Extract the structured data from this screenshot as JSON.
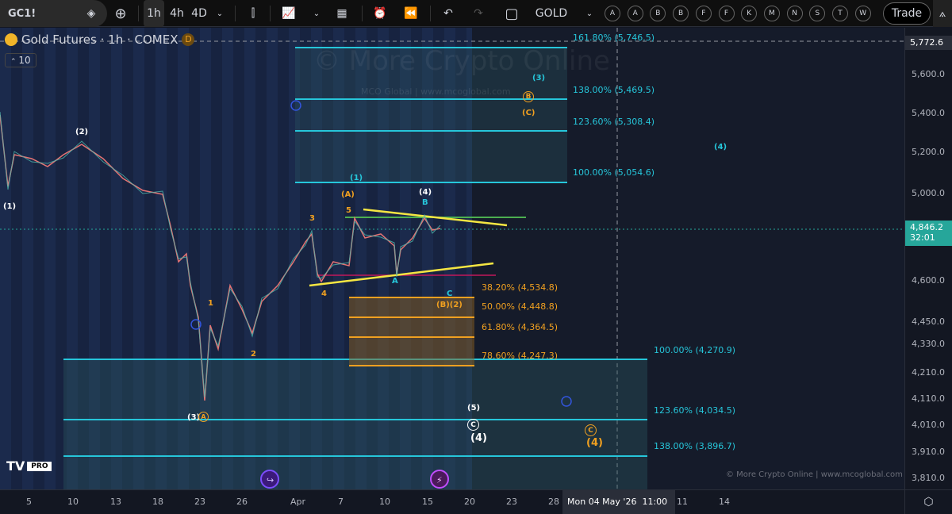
{
  "toolbar": {
    "symbol": "GC1!",
    "timeframes": [
      "1h",
      "4h",
      "4D"
    ],
    "active_timeframe": "1h",
    "watchlist": "GOLD",
    "quick_symbols": [
      "A",
      "A",
      "B",
      "B",
      "F",
      "F",
      "K",
      "M",
      "N",
      "S",
      "T",
      "W"
    ],
    "trade_label": "Trade"
  },
  "legend": {
    "title": "Gold Futures · 1h · COMEX",
    "badge": "D",
    "interval_box": "10"
  },
  "watermark": {
    "main": "© More Crypto Online",
    "sub": "MCO Global  |  www.mcoglobal.com",
    "footer": "© More Crypto Online  |  www.mcoglobal.com"
  },
  "price_axis": {
    "labels": [
      "5,600.0",
      "5,400.0",
      "5,200.0",
      "5,000.0",
      "4,600.0",
      "4,450.0",
      "4,330.0",
      "4,210.0",
      "4,110.0",
      "4,010.0",
      "3,910.0",
      "3,810.0"
    ],
    "crosshair_price": "5,772.6",
    "last_price": "4,846.2",
    "countdown": "32:01",
    "last_price_color": "#26a69a"
  },
  "time_axis": {
    "labels": [
      "5",
      "10",
      "13",
      "18",
      "23",
      "26",
      "Apr",
      "7",
      "10",
      "15",
      "20",
      "23",
      "28",
      "11",
      "14"
    ],
    "crosshair_time": "Mon 04 May '26",
    "crosshair_hour": "11:00"
  },
  "fib_upper": [
    "161.80% (5,746.5)",
    "138.00% (5,469.5)",
    "123.60% (5,308.4)",
    "100.00% (5,054.6)"
  ],
  "fib_retrace": [
    "38.20% (4,534.8)",
    "50.00% (4,448.8)",
    "61.80% (4,364.5)",
    "78.60% (4,247.3)"
  ],
  "fib_lower": [
    "100.00% (4,270.9)",
    "123.60% (4,034.5)",
    "138.00% (3,896.7)"
  ],
  "waves": {
    "w1": "(1)",
    "w2": "(2)",
    "w3": "(3)",
    "w3a": "A",
    "sub1": "1",
    "sub2": "2",
    "sub3": "3",
    "sub4": "4",
    "sub5": "5",
    "A": "(A)",
    "w4top": "(4)",
    "B": "B",
    "a": "A",
    "C": "C",
    "B2": "(B)(2)",
    "w1b": "(1)",
    "w3b": "(3)",
    "Bc": "B",
    "Cc": "(C)",
    "w4r": "(4)",
    "w5": "(5)",
    "Cw": "C",
    "w4w": "(4)",
    "Co": "C",
    "w4o": "(4)"
  },
  "logo": {
    "text": "PRO"
  },
  "colors": {
    "cyan": "#26c6da",
    "orange": "#f0a020",
    "yellow": "#f5e642",
    "green": "#4caf50"
  }
}
